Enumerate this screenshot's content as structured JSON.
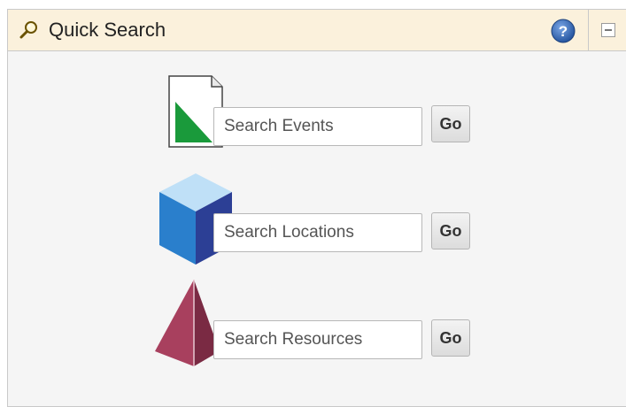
{
  "panel": {
    "title": "Quick Search",
    "icons": {
      "title_icon": "magnifier-icon",
      "help_icon": "help-icon",
      "collapse_icon": "collapse-icon"
    }
  },
  "searches": [
    {
      "placeholder": "Search Events",
      "go_label": "Go",
      "icon": "document-icon"
    },
    {
      "placeholder": "Search Locations",
      "go_label": "Go",
      "icon": "cube-icon"
    },
    {
      "placeholder": "Search Resources",
      "go_label": "Go",
      "icon": "pyramid-icon"
    }
  ],
  "colors": {
    "header_bg": "#fbf1dc",
    "body_bg": "#f5f5f5",
    "help_blue": "#3b6fb5",
    "events_green": "#1a9a3b",
    "locations_blue": "#2a7fcc",
    "resources_maroon": "#a8405e"
  }
}
